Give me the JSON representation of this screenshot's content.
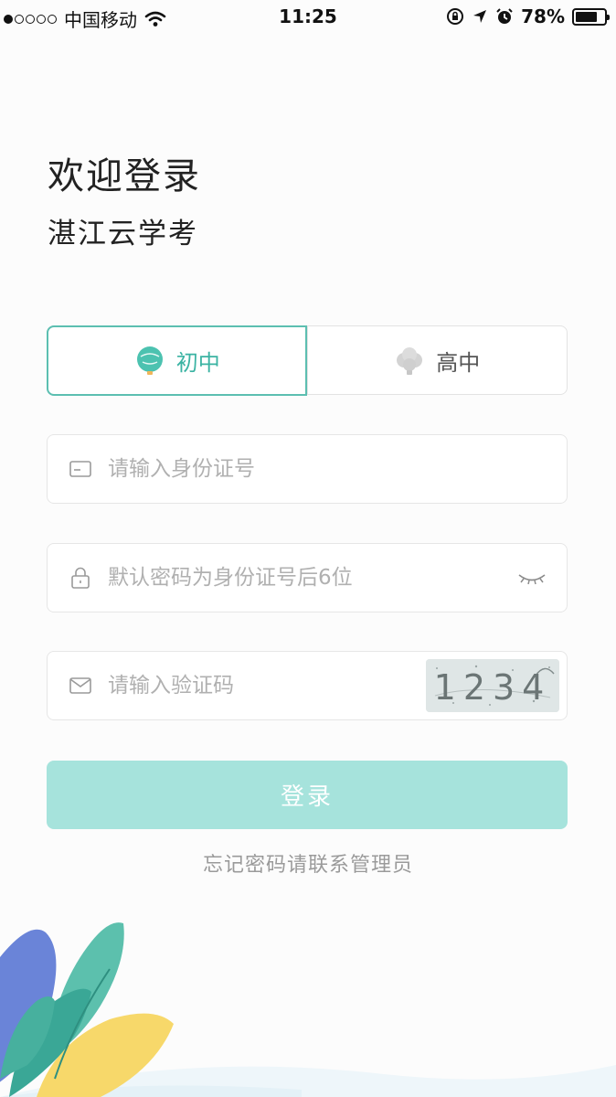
{
  "status_bar": {
    "carrier": "中国移动",
    "time": "11:25",
    "battery": "78%",
    "battery_level": 0.78
  },
  "header": {
    "welcome": "欢迎登录",
    "app_name": "湛江云学考"
  },
  "level_tabs": [
    {
      "label": "初中",
      "active": true,
      "icon": "junior-badge-icon"
    },
    {
      "label": "高中",
      "active": false,
      "icon": "senior-badge-icon"
    }
  ],
  "form": {
    "id_placeholder": "请输入身份证号",
    "password_placeholder": "默认密码为身份证号后6位",
    "captcha_placeholder": "请输入验证码",
    "captcha_text": "1234"
  },
  "login_label": "登录",
  "forgot_text": "忘记密码请联系管理员",
  "colors": {
    "accent": "#5cbfb1",
    "button_bg": "#a6e3dc",
    "placeholder": "#b0b0b0"
  }
}
